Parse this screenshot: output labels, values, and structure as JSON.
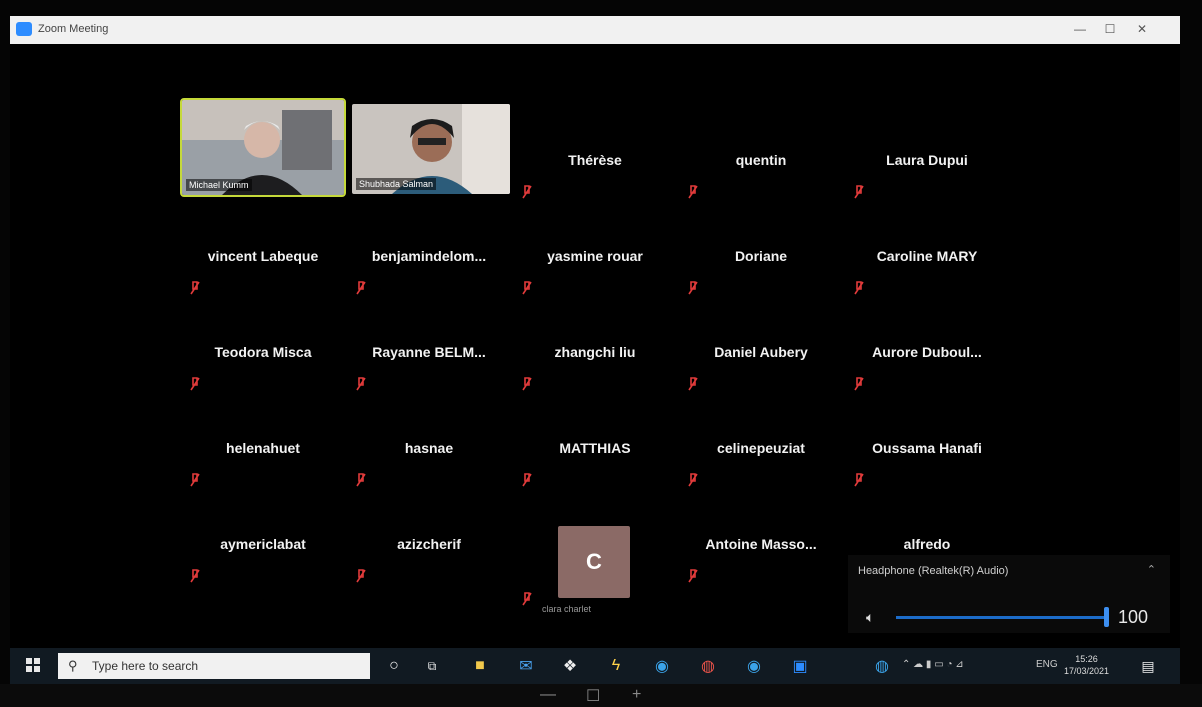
{
  "window": {
    "title": "Zoom Meeting",
    "minimize": "—",
    "maximize": "☐",
    "close": "✕"
  },
  "video_participants": [
    {
      "name": "Michael Kumm"
    },
    {
      "name": "Shubhada Salman"
    }
  ],
  "participants": [
    "Thérèse",
    "quentin",
    "Laura Dupui",
    "vincent Labeque",
    "benjamindelom...",
    "yasmine rouar",
    "Doriane",
    "Caroline MARY",
    "Teodora Misca",
    "Rayanne  BELM...",
    "zhangchi liu",
    "Daniel Aubery",
    "Aurore  Duboul...",
    "helenahuet",
    "hasnae",
    "MATTHIAS",
    "celinepeuziat",
    "Oussama Hanafi",
    "aymericlabat",
    "azizcherif",
    "Antoine  Masso...",
    "alfredo"
  ],
  "avatar_tile": {
    "initial": "C",
    "name": "clara charlet"
  },
  "audio": {
    "device": "Headphone (Realtek(R) Audio)",
    "volume": "100",
    "volume_level": 1.0
  },
  "taskbar": {
    "search_placeholder": "Type here to search",
    "tray_lang": "ENG",
    "time": "15:26",
    "date": "17/03/2021"
  },
  "bottom": {
    "minus": "—",
    "box": "☐",
    "plus": "+"
  }
}
